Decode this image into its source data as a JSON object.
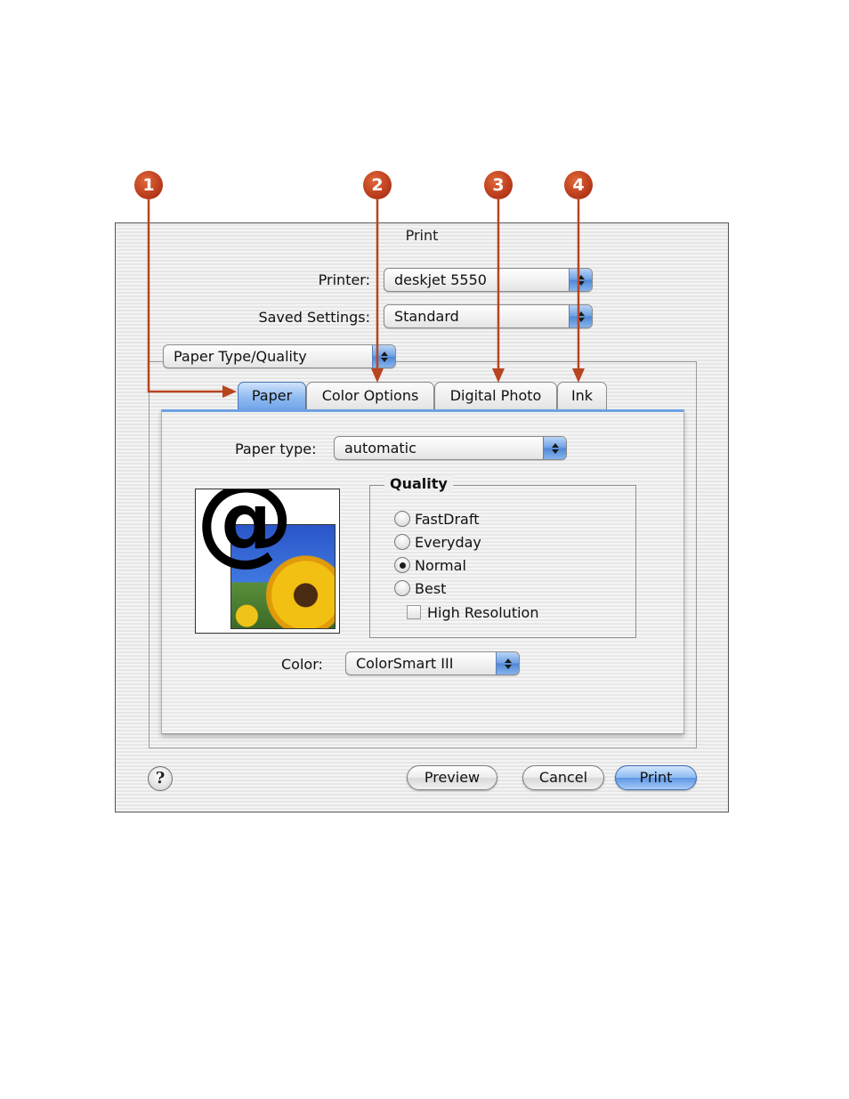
{
  "callouts": [
    "1",
    "2",
    "3",
    "4"
  ],
  "dialog": {
    "title": "Print",
    "printer_label": "Printer:",
    "printer_value": "deskjet 5550",
    "saved_settings_label": "Saved Settings:",
    "saved_settings_value": "Standard",
    "panel_menu_value": "Paper Type/Quality"
  },
  "tabs": [
    {
      "label": "Paper",
      "active": true
    },
    {
      "label": "Color Options",
      "active": false
    },
    {
      "label": "Digital Photo",
      "active": false
    },
    {
      "label": "Ink",
      "active": false
    }
  ],
  "paper_panel": {
    "paper_type_label": "Paper type:",
    "paper_type_value": "automatic",
    "quality_title": "Quality",
    "quality_options": [
      {
        "label": "FastDraft",
        "selected": false
      },
      {
        "label": "Everyday",
        "selected": false
      },
      {
        "label": "Normal",
        "selected": true
      },
      {
        "label": "Best",
        "selected": false
      }
    ],
    "high_resolution_label": "High Resolution",
    "high_resolution_checked": false,
    "color_label": "Color:",
    "color_value": "ColorSmart III",
    "preview_glyph": "@"
  },
  "buttons": {
    "help": "?",
    "preview": "Preview",
    "cancel": "Cancel",
    "print": "Print"
  },
  "colors": {
    "callout": "#b8391a",
    "arrow": "#b84420",
    "accent_blue": "#6ea1e6"
  }
}
